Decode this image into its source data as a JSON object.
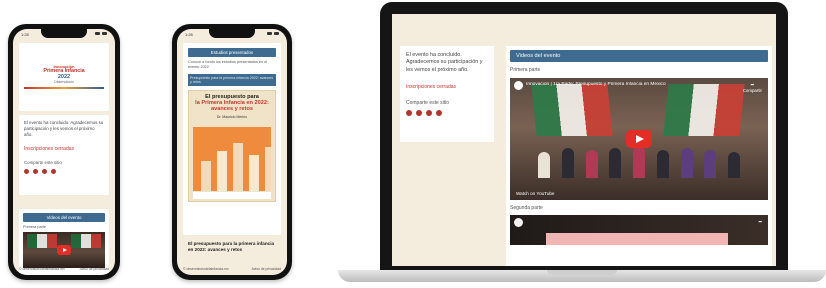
{
  "phone1": {
    "time": "1:28",
    "logo": {
      "line1": "Innovación",
      "line2": "Primera Infancia",
      "line3": "2022",
      "line4": "Observatorio"
    },
    "intro_text": "El evento ha concluido. Agradecemos su participación y les vemos el próximo año.",
    "register_link": "Inscripciones cerradas",
    "share_label": "Comparte este sitio",
    "video_section_title": "Videos del evento",
    "first_part_label": "Primera parte",
    "footer_url": "© observatoriodelainfancia.mx",
    "footer_right": "Aviso de privacidad"
  },
  "phone2": {
    "time": "1:28",
    "header_bar": "Estudios presentados",
    "description": "Conoce a fondo los estudios presentados en el evento 2022",
    "banner": "Presupuesto para la primera infancia 2022: avances y retos",
    "poster_title_a": "El presupuesto para",
    "poster_title_b": "la Primera Infancia en 2022: avances y retos",
    "poster_sub": "Dr. Mauricio Merino",
    "caption": "El presupuesto para la primera infancia en 2022: avances y retos",
    "footer_url": "© observatoriodelainfancia.mx",
    "footer_right": "Aviso de privacidad"
  },
  "laptop": {
    "intro_text": "El evento ha concluido. Agradecemos su participación y les vemos el próximo año.",
    "register_link": "Inscripciones cerradas",
    "share_label": "Comparte este sitio",
    "video_section_title": "Videos del evento",
    "first_part_label": "Primera parte",
    "video_title": "Innovación | 1ra Parte: Presupuesto y Primera Infancia en México",
    "share_button": "Compartir",
    "watch_on": "Watch on YouTube",
    "second_part_label": "Segunda parte"
  }
}
